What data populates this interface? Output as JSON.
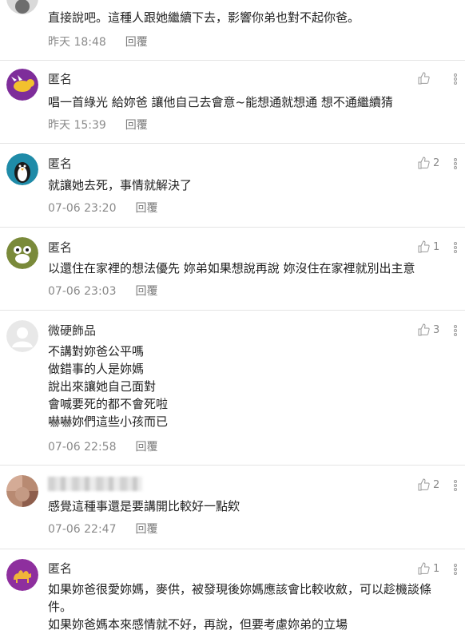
{
  "comments": [
    {
      "name": "",
      "text_lines": [
        "直接說吧。這種人跟她繼續下去，影響你弟也對不起你爸。"
      ],
      "time": "昨天 18:48",
      "reply_label": "回覆",
      "likes": ""
    },
    {
      "name": "匿名",
      "text_lines": [
        "唱一首綠光 給妳爸 讓他自己去會意~能想通就想通 想不通繼續猜"
      ],
      "time": "昨天 15:39",
      "reply_label": "回覆",
      "likes": ""
    },
    {
      "name": "匿名",
      "text_lines": [
        "就讓她去死，事情就解決了"
      ],
      "time": "07-06 23:20",
      "reply_label": "回覆",
      "likes": "2"
    },
    {
      "name": "匿名",
      "text_lines": [
        "以還住在家裡的想法優先 妳弟如果想說再說 妳沒住在家裡就別出主意"
      ],
      "time": "07-06 23:03",
      "reply_label": "回覆",
      "likes": "1"
    },
    {
      "name": "微硬飾品",
      "text_lines": [
        "不講對妳爸公平嗎",
        "做錯事的人是妳媽",
        "說出來讓她自己面對",
        "會喊要死的都不會死啦",
        "嚇嚇妳們這些小孩而已"
      ],
      "time": "07-06 22:58",
      "reply_label": "回覆",
      "likes": "3"
    },
    {
      "name": "",
      "text_lines": [
        "感覺這種事還是要講開比較好一點欸"
      ],
      "time": "07-06 22:47",
      "reply_label": "回覆",
      "likes": "2"
    },
    {
      "name": "匿名",
      "text_lines": [
        "如果妳爸很愛妳媽，麥供，被發現後妳媽應該會比較收斂，可以趁機談條",
        "件。",
        "如果妳爸媽本來感情就不好，再說，但要考慮妳弟的立場"
      ],
      "time": "",
      "reply_label": "",
      "likes": "1"
    }
  ],
  "icons": {
    "like": "thumbs-up-icon",
    "more": "more-vertical-icon"
  },
  "colors": {
    "meta": "#8a8a8a",
    "divider": "#e4e4e4"
  }
}
